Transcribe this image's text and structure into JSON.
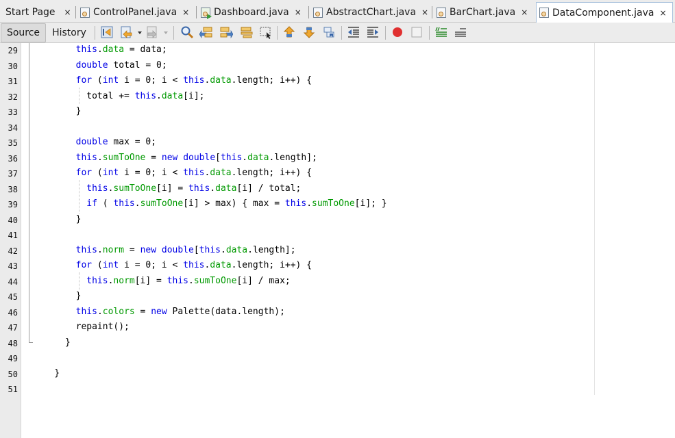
{
  "tabs": [
    {
      "label": "Start Page",
      "icon": "none",
      "active": false
    },
    {
      "label": "ControlPanel.java",
      "icon": "java-file-icon",
      "active": false
    },
    {
      "label": "Dashboard.java",
      "icon": "java-run-file-icon",
      "active": false
    },
    {
      "label": "AbstractChart.java",
      "icon": "java-file-icon",
      "active": false
    },
    {
      "label": "BarChart.java",
      "icon": "java-file-icon",
      "active": false
    },
    {
      "label": "DataComponent.java",
      "icon": "java-file-icon",
      "active": true
    }
  ],
  "close_glyph": "×",
  "toolbar": {
    "source_label": "Source",
    "history_label": "History",
    "icons": [
      "last-edit-icon",
      "back-icon",
      "forward-icon",
      "find-icon",
      "find-previous-icon",
      "find-next-icon",
      "toggle-highlight-icon",
      "find-selection-icon",
      "previous-bookmark-icon",
      "next-bookmark-icon",
      "toggle-bookmark-icon",
      "shift-left-icon",
      "shift-right-icon",
      "start-macro-icon",
      "stop-macro-icon",
      "comment-icon",
      "uncomment-icon"
    ]
  },
  "editor": {
    "lines": [
      {
        "num": "29",
        "tokens": [
          [
            "",
            "        "
          ],
          [
            "kw",
            "this"
          ],
          [
            "",
            "."
          ],
          [
            "fld",
            "data"
          ],
          [
            "",
            " = data;"
          ]
        ]
      },
      {
        "num": "30",
        "tokens": [
          [
            "",
            "        "
          ],
          [
            "kw",
            "double"
          ],
          [
            "",
            " total = 0;"
          ]
        ]
      },
      {
        "num": "31",
        "tokens": [
          [
            "",
            "        "
          ],
          [
            "kw",
            "for"
          ],
          [
            "",
            " ("
          ],
          [
            "kw",
            "int"
          ],
          [
            "",
            " i = 0; i < "
          ],
          [
            "kw",
            "this"
          ],
          [
            "",
            "."
          ],
          [
            "fld",
            "data"
          ],
          [
            "",
            ".length; i++) {"
          ]
        ]
      },
      {
        "num": "32",
        "tokens": [
          [
            "",
            "          total += "
          ],
          [
            "kw",
            "this"
          ],
          [
            "",
            "."
          ],
          [
            "fld",
            "data"
          ],
          [
            "",
            "[i];"
          ]
        ]
      },
      {
        "num": "33",
        "tokens": [
          [
            "",
            "        }"
          ]
        ]
      },
      {
        "num": "34",
        "tokens": []
      },
      {
        "num": "35",
        "tokens": [
          [
            "",
            "        "
          ],
          [
            "kw",
            "double"
          ],
          [
            "",
            " max = 0;"
          ]
        ]
      },
      {
        "num": "36",
        "tokens": [
          [
            "",
            "        "
          ],
          [
            "kw",
            "this"
          ],
          [
            "",
            "."
          ],
          [
            "fld",
            "sumToOne"
          ],
          [
            "",
            " = "
          ],
          [
            "kw",
            "new"
          ],
          [
            "",
            " "
          ],
          [
            "kw",
            "double"
          ],
          [
            "",
            "["
          ],
          [
            "kw",
            "this"
          ],
          [
            "",
            "."
          ],
          [
            "fld",
            "data"
          ],
          [
            "",
            ".length];"
          ]
        ]
      },
      {
        "num": "37",
        "tokens": [
          [
            "",
            "        "
          ],
          [
            "kw",
            "for"
          ],
          [
            "",
            " ("
          ],
          [
            "kw",
            "int"
          ],
          [
            "",
            " i = 0; i < "
          ],
          [
            "kw",
            "this"
          ],
          [
            "",
            "."
          ],
          [
            "fld",
            "data"
          ],
          [
            "",
            ".length; i++) {"
          ]
        ]
      },
      {
        "num": "38",
        "tokens": [
          [
            "",
            "          "
          ],
          [
            "kw",
            "this"
          ],
          [
            "",
            "."
          ],
          [
            "fld",
            "sumToOne"
          ],
          [
            "",
            "[i] = "
          ],
          [
            "kw",
            "this"
          ],
          [
            "",
            "."
          ],
          [
            "fld",
            "data"
          ],
          [
            "",
            "[i] / total;"
          ]
        ]
      },
      {
        "num": "39",
        "tokens": [
          [
            "",
            "          "
          ],
          [
            "kw",
            "if"
          ],
          [
            "",
            " ( "
          ],
          [
            "kw",
            "this"
          ],
          [
            "",
            "."
          ],
          [
            "fld",
            "sumToOne"
          ],
          [
            "",
            "[i] > max) { max = "
          ],
          [
            "kw",
            "this"
          ],
          [
            "",
            "."
          ],
          [
            "fld",
            "sumToOne"
          ],
          [
            "",
            "[i]; }"
          ]
        ]
      },
      {
        "num": "40",
        "tokens": [
          [
            "",
            "        }"
          ]
        ]
      },
      {
        "num": "41",
        "tokens": []
      },
      {
        "num": "42",
        "tokens": [
          [
            "",
            "        "
          ],
          [
            "kw",
            "this"
          ],
          [
            "",
            "."
          ],
          [
            "fld",
            "norm"
          ],
          [
            "",
            " = "
          ],
          [
            "kw",
            "new"
          ],
          [
            "",
            " "
          ],
          [
            "kw",
            "double"
          ],
          [
            "",
            "["
          ],
          [
            "kw",
            "this"
          ],
          [
            "",
            "."
          ],
          [
            "fld",
            "data"
          ],
          [
            "",
            ".length];"
          ]
        ]
      },
      {
        "num": "43",
        "tokens": [
          [
            "",
            "        "
          ],
          [
            "kw",
            "for"
          ],
          [
            "",
            " ("
          ],
          [
            "kw",
            "int"
          ],
          [
            "",
            " i = 0; i < "
          ],
          [
            "kw",
            "this"
          ],
          [
            "",
            "."
          ],
          [
            "fld",
            "data"
          ],
          [
            "",
            ".length; i++) {"
          ]
        ]
      },
      {
        "num": "44",
        "tokens": [
          [
            "",
            "          "
          ],
          [
            "kw",
            "this"
          ],
          [
            "",
            "."
          ],
          [
            "fld",
            "norm"
          ],
          [
            "",
            "[i] = "
          ],
          [
            "kw",
            "this"
          ],
          [
            "",
            "."
          ],
          [
            "fld",
            "sumToOne"
          ],
          [
            "",
            "[i] / max;"
          ]
        ]
      },
      {
        "num": "45",
        "tokens": [
          [
            "",
            "        }"
          ]
        ]
      },
      {
        "num": "46",
        "tokens": [
          [
            "",
            "        "
          ],
          [
            "kw",
            "this"
          ],
          [
            "",
            "."
          ],
          [
            "fld",
            "colors"
          ],
          [
            "",
            " = "
          ],
          [
            "kw",
            "new"
          ],
          [
            "",
            " Palette(data.length);"
          ]
        ]
      },
      {
        "num": "47",
        "tokens": [
          [
            "",
            "        repaint();"
          ]
        ]
      },
      {
        "num": "48",
        "tokens": [
          [
            "",
            "      }"
          ]
        ]
      },
      {
        "num": "49",
        "tokens": []
      },
      {
        "num": "50",
        "tokens": [
          [
            "",
            "    }"
          ]
        ]
      },
      {
        "num": "51",
        "tokens": []
      }
    ]
  },
  "colors": {
    "keyword": "#0000e6",
    "field": "#009900",
    "text": "#000000",
    "gutter": "#ebebeb",
    "macro_record": "#e03030"
  }
}
